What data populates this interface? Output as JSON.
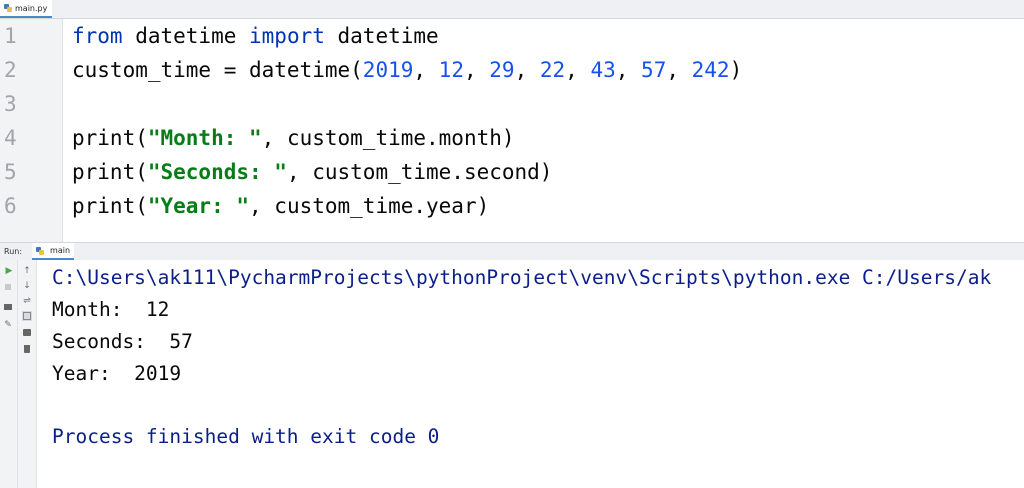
{
  "editor": {
    "tab_label": "main.py",
    "line_numbers": [
      "1",
      "2",
      "3",
      "4",
      "5",
      "6"
    ],
    "code": {
      "l1_kw1": "from",
      "l1_t1": " datetime ",
      "l1_kw2": "import",
      "l1_t2": " datetime",
      "l2_t1": "custom_time = datetime(",
      "l2_n1": "2019",
      "l2_n2": "12",
      "l2_n3": "29",
      "l2_n4": "22",
      "l2_n5": "43",
      "l2_n6": "57",
      "l2_n7": "242",
      "l2_sep": ", ",
      "l2_close": ")",
      "l4_t1": "print(",
      "l4_s": "\"Month: \"",
      "l4_t2": ", custom_time.month)",
      "l5_t1": "print(",
      "l5_s": "\"Seconds: \"",
      "l5_t2": ", custom_time.second)",
      "l6_t1": "print(",
      "l6_s": "\"Year: \"",
      "l6_t2": ", custom_time.year)"
    }
  },
  "run_panel": {
    "prefix": "Run:",
    "tab_label": "main",
    "output": [
      "C:\\Users\\ak111\\PycharmProjects\\pythonProject\\venv\\Scripts\\python.exe C:/Users/ak",
      "Month:  12",
      "Seconds:  57",
      "Year:  2019",
      "",
      "Process finished with exit code 0"
    ]
  },
  "colors": {
    "keyword": "#0033b3",
    "number": "#1750eb",
    "string": "#067d17",
    "system_output": "#0b1e8a",
    "accent": "#4a88c7"
  },
  "icons": {
    "toolbar_left": [
      "rerun-icon",
      "stop-icon",
      "layout-icon",
      "pin-icon"
    ],
    "toolbar_right": [
      "scroll-up-icon",
      "scroll-down-icon",
      "soft-wrap-icon",
      "scroll-to-end-icon",
      "print-icon",
      "trash-icon"
    ]
  }
}
